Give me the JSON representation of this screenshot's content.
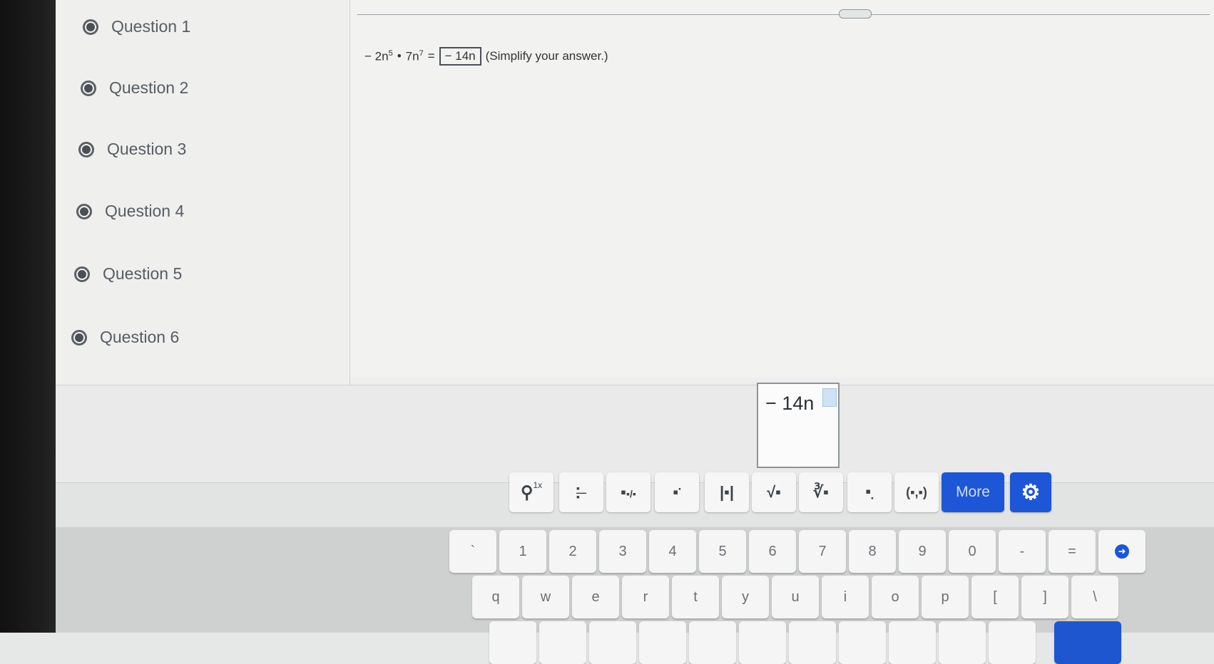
{
  "sidebar": {
    "questions": [
      {
        "label": "Question 1"
      },
      {
        "label": "Question 2"
      },
      {
        "label": "Question 3"
      },
      {
        "label": "Question 4"
      },
      {
        "label": "Question 5"
      },
      {
        "label": "Question 6"
      }
    ]
  },
  "question": {
    "lhs_a": "− 2n",
    "lhs_a_exp": "5",
    "dot": "•",
    "lhs_b": "7n",
    "lhs_b_exp": "7",
    "equals": "=",
    "answer": "− 14n",
    "instruction": "(Simplify your answer.)"
  },
  "answer_input": {
    "value": "− 14n"
  },
  "toolbar": {
    "tools": [
      {
        "name": "zoom-tool",
        "glyph": "🔍︎",
        "label": "1x"
      },
      {
        "name": "fraction-tool",
        "glyph": "▪⁄▪"
      },
      {
        "name": "mixed-number-tool",
        "glyph": "▪▪⁄▪"
      },
      {
        "name": "exponent-tool",
        "glyph": "▪ᐧ"
      },
      {
        "name": "absolute-value-tool",
        "glyph": "|▪|"
      },
      {
        "name": "square-root-tool",
        "glyph": "√▪"
      },
      {
        "name": "nth-root-tool",
        "glyph": "∛▪"
      },
      {
        "name": "subscript-tool",
        "glyph": "▪."
      },
      {
        "name": "ordered-pair-tool",
        "glyph": "(▪,▪)"
      }
    ],
    "more_label": "More",
    "settings_icon": "gear-icon"
  },
  "keyboard": {
    "row1": [
      "`",
      "1",
      "2",
      "3",
      "4",
      "5",
      "6",
      "7",
      "8",
      "9",
      "0",
      "-",
      "="
    ],
    "row2": [
      "q",
      "w",
      "e",
      "r",
      "t",
      "y",
      "u",
      "i",
      "o",
      "p",
      "[",
      "]",
      "\\"
    ]
  },
  "colors": {
    "accent": "#1d56d6",
    "background": "#edeeed"
  }
}
